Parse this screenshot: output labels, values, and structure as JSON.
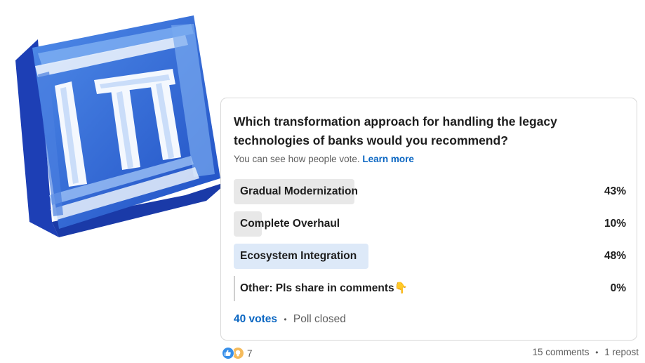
{
  "poll": {
    "question": "Which transformation approach for handling the legacy technologies of banks would you recommend?",
    "visibility_note": "You can see how people vote.",
    "learn_more": "Learn more",
    "options": [
      {
        "label": "Gradual Modernization",
        "percent_text": "43%",
        "percent": 43,
        "selected": false
      },
      {
        "label": "Complete Overhaul",
        "percent_text": "10%",
        "percent": 10,
        "selected": false
      },
      {
        "label": "Ecosystem Integration",
        "percent_text": "48%",
        "percent": 48,
        "selected": true
      },
      {
        "label": "Other: Pls share in comments👇",
        "percent_text": "0%",
        "percent": 0,
        "selected": false
      }
    ],
    "votes": "40 votes",
    "status": "Poll closed"
  },
  "social": {
    "reaction_icons": [
      "like-icon",
      "insightful-icon"
    ],
    "reaction_count": "7",
    "comments": "15 comments",
    "reposts": "1 repost"
  },
  "colors": {
    "accent": "#0a66c2",
    "bar": "#e8e8e8",
    "bar_selected": "#dde9f8",
    "logo_blue": "#2c63d4"
  }
}
